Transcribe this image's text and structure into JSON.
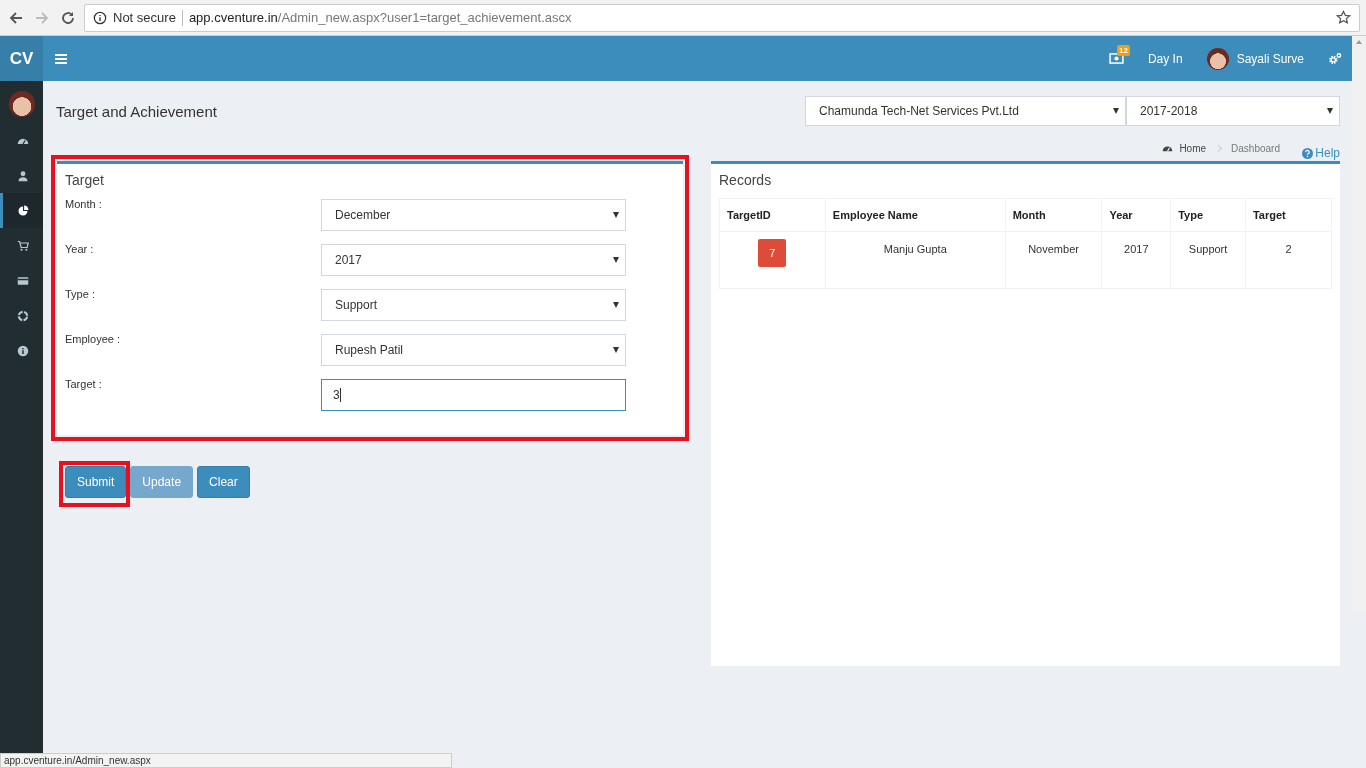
{
  "browser": {
    "security": "Not secure",
    "url_host": "app.cventure.in",
    "url_path": "/Admin_new.aspx?user1=target_achievement.ascx",
    "status_url": "app.cventure.in/Admin_new.aspx"
  },
  "header": {
    "logo": "CV",
    "notification_count": "12",
    "day_in": "Day In",
    "user_name": "Sayali Surve"
  },
  "sidebar": {
    "items": [
      {
        "kind": "dashboard",
        "selected": false
      },
      {
        "kind": "user",
        "selected": false
      },
      {
        "kind": "chart",
        "selected": true
      },
      {
        "kind": "cart",
        "selected": false
      },
      {
        "kind": "card",
        "selected": false
      },
      {
        "kind": "support",
        "selected": false
      },
      {
        "kind": "info",
        "selected": false
      }
    ]
  },
  "page": {
    "title": "Target and Achievement",
    "company": "Chamunda Tech-Net Services Pvt.Ltd",
    "year": "2017-2018",
    "breadcrumb": [
      "Home",
      "Dashboard"
    ],
    "help": "Help"
  },
  "form": {
    "title": "Target",
    "highlighted": true,
    "fields": [
      {
        "label": "Month :",
        "kind": "select",
        "value": "December"
      },
      {
        "label": "Year :",
        "kind": "select",
        "value": "2017"
      },
      {
        "label": "Type :",
        "kind": "select",
        "value": "Support"
      },
      {
        "label": "Employee :",
        "kind": "select",
        "value": "Rupesh Patil"
      },
      {
        "label": "Target :",
        "kind": "text",
        "value": "3"
      }
    ]
  },
  "buttons": [
    {
      "label": "Submit",
      "disabled": false,
      "highlighted": true
    },
    {
      "label": "Update",
      "disabled": true,
      "highlighted": false
    },
    {
      "label": "Clear",
      "disabled": false,
      "highlighted": false
    }
  ],
  "records": {
    "title": "Records",
    "columns": [
      "TargetID",
      "Employee Name",
      "Month",
      "Year",
      "Type",
      "Target"
    ],
    "rows": [
      [
        "7",
        "Manju Gupta",
        "November",
        "2017",
        "Support",
        "2"
      ]
    ]
  }
}
